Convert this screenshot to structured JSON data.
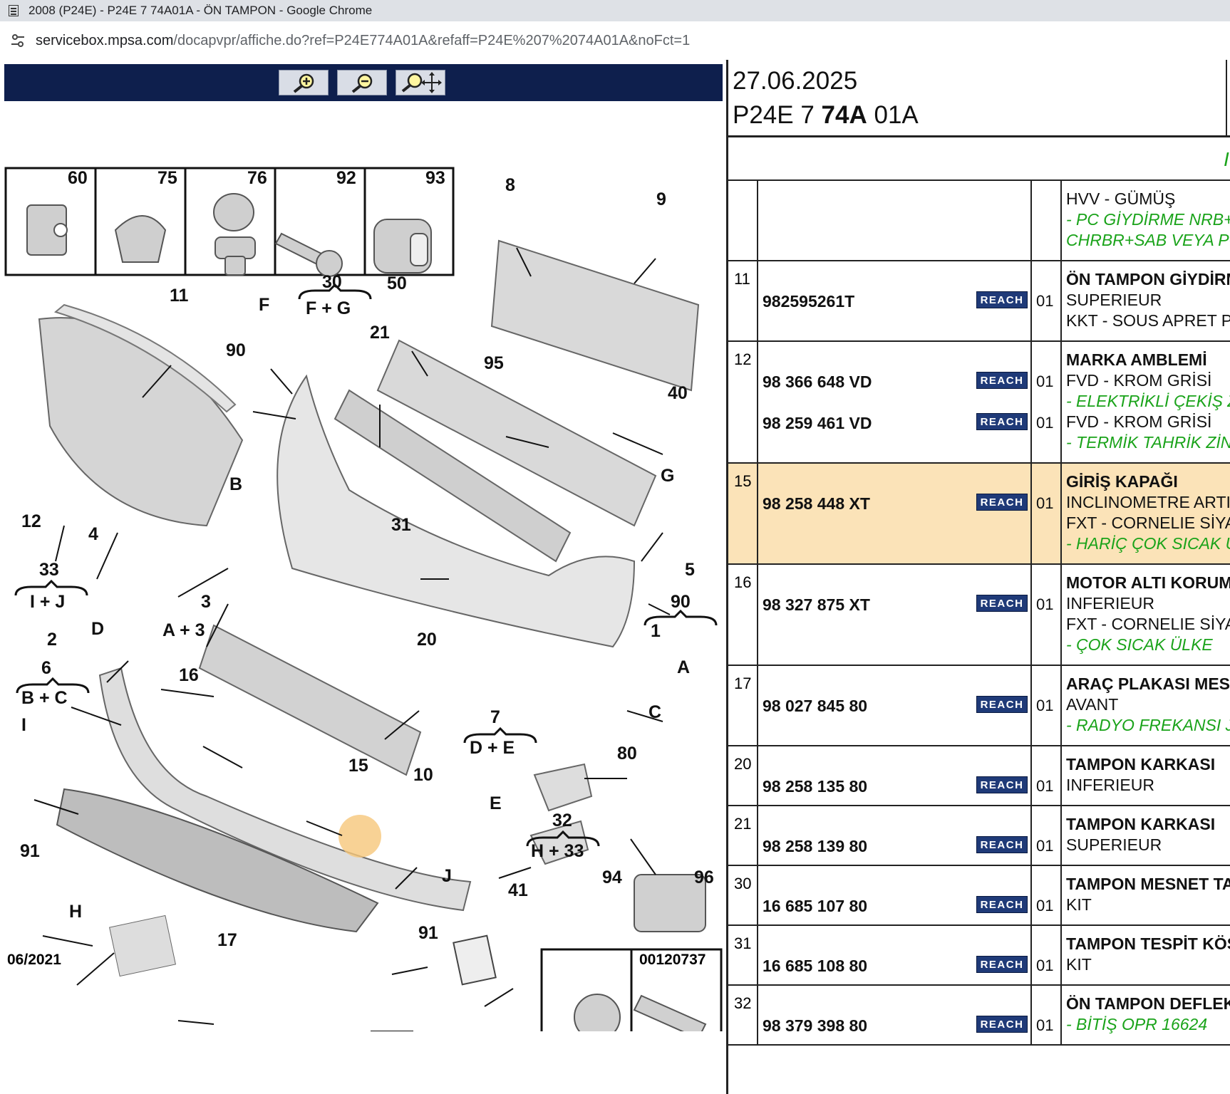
{
  "browser": {
    "title": "2008 (P24E) - P24E 7 74A01A - ÖN TAMPON - Google Chrome",
    "url_host": "servicebox.mpsa.com",
    "url_path": "/docapvpr/affiche.do?ref=P24E774A01A&refaff=P24E%207%2074A01A&noFct=1"
  },
  "toolbar": {
    "zoom_in": "zoom-in-icon",
    "zoom_out": "zoom-out-icon",
    "pan": "zoom-pan-icon"
  },
  "diagram": {
    "date": "06/2021",
    "code": "00120737",
    "highlight_color": "#f6c77a",
    "callouts": [
      "60",
      "75",
      "76",
      "92",
      "93",
      "8",
      "9",
      "11",
      "F",
      "30",
      "F + G",
      "50",
      "21",
      "90",
      "95",
      "40",
      "12",
      "4",
      "B",
      "31",
      "G",
      "33",
      "I + J",
      "3",
      "D",
      "5",
      "90",
      "1",
      "A + 3",
      "2",
      "20",
      "A",
      "6",
      "B + C",
      "16",
      "7",
      "D + E",
      "C",
      "I",
      "15",
      "80",
      "10",
      "E",
      "91",
      "32",
      "H + 33",
      "J",
      "41",
      "94",
      "96",
      "H",
      "17",
      "91"
    ]
  },
  "panel": {
    "date": "27.06.2025",
    "ref_prefix": "P24E 7 ",
    "ref_bold": "74A",
    "ref_suffix": " 01A",
    "band_mark": "I"
  },
  "rows": [
    {
      "no": "",
      "parts": [],
      "desc": [
        {
          "text": "HVV - GÜMÜŞ",
          "style": "n"
        },
        {
          "text": "- PC GİYDİRME NRB+IZ",
          "style": "g"
        },
        {
          "text": "CHRBR+SAB VEYA PC",
          "style": "g"
        }
      ]
    },
    {
      "no": "11",
      "parts": [
        {
          "pn": "982595261T",
          "qty": "01"
        }
      ],
      "desc": [
        {
          "text": "ÖN TAMPON GİYDİRME",
          "style": "t"
        },
        {
          "text": "SUPERIEUR",
          "style": "n"
        },
        {
          "text": "KKT - SOUS APRET PR",
          "style": "n"
        }
      ]
    },
    {
      "no": "12",
      "parts": [
        {
          "pn": "98 366 648 VD",
          "qty": "01"
        },
        {
          "pn": "98 259 461 VD",
          "qty": "01"
        }
      ],
      "desc": [
        {
          "text": "MARKA AMBLEMİ",
          "style": "t"
        },
        {
          "text": "FVD - KROM GRİSİ",
          "style": "n"
        },
        {
          "text": "- ELEKTRİKLİ ÇEKİŞ ZI",
          "style": "g"
        },
        {
          "text": "FVD - KROM GRİSİ",
          "style": "n"
        },
        {
          "text": "- TERMİK TAHRİK ZİNC",
          "style": "g"
        }
      ]
    },
    {
      "no": "15",
      "highlight": true,
      "parts": [
        {
          "pn": "98 258 448 XT",
          "qty": "01"
        }
      ],
      "desc": [
        {
          "text": "GİRİŞ KAPAĞI",
          "style": "t"
        },
        {
          "text": "INCLINOMETRE ARTIV",
          "style": "n"
        },
        {
          "text": "FXT - CORNELIE SİYAH",
          "style": "n"
        },
        {
          "text": "- HARİÇ ÇOK SICAK ÜL",
          "style": "g"
        }
      ]
    },
    {
      "no": "16",
      "parts": [
        {
          "pn": "98 327 875 XT",
          "qty": "01"
        }
      ],
      "desc": [
        {
          "text": "MOTOR ALTI KORUMA",
          "style": "t"
        },
        {
          "text": "INFERIEUR",
          "style": "n"
        },
        {
          "text": "FXT - CORNELIE SİYAH",
          "style": "n"
        },
        {
          "text": "- ÇOK SICAK ÜLKE",
          "style": "g"
        }
      ]
    },
    {
      "no": "17",
      "parts": [
        {
          "pn": "98 027 845 80",
          "qty": "01"
        }
      ],
      "desc": [
        {
          "text": "ARAÇ PLAKASI MESNE",
          "style": "t"
        },
        {
          "text": "AVANT",
          "style": "n"
        },
        {
          "text": "- RADYO FREKANSI JA",
          "style": "g"
        }
      ]
    },
    {
      "no": "20",
      "parts": [
        {
          "pn": "98 258 135 80",
          "qty": "01"
        }
      ],
      "desc": [
        {
          "text": "TAMPON KARKASI",
          "style": "t"
        },
        {
          "text": "INFERIEUR",
          "style": "n"
        }
      ]
    },
    {
      "no": "21",
      "parts": [
        {
          "pn": "98 258 139 80",
          "qty": "01"
        }
      ],
      "desc": [
        {
          "text": "TAMPON KARKASI",
          "style": "t"
        },
        {
          "text": "SUPERIEUR",
          "style": "n"
        }
      ]
    },
    {
      "no": "30",
      "parts": [
        {
          "pn": "16 685 107 80",
          "qty": "01"
        }
      ],
      "desc": [
        {
          "text": "TAMPON MESNET TAK",
          "style": "t"
        },
        {
          "text": "KIT",
          "style": "n"
        }
      ]
    },
    {
      "no": "31",
      "parts": [
        {
          "pn": "16 685 108 80",
          "qty": "01"
        }
      ],
      "desc": [
        {
          "text": "TAMPON TESPİT KÖŞE",
          "style": "t"
        },
        {
          "text": "KIT",
          "style": "n"
        }
      ]
    },
    {
      "no": "32",
      "parts": [
        {
          "pn": "98 379 398 80",
          "qty": "01"
        }
      ],
      "desc": [
        {
          "text": "ÖN TAMPON DEFLEKT",
          "style": "t"
        },
        {
          "text": "- BİTİŞ OPR 16624",
          "style": "g"
        }
      ]
    }
  ],
  "reach_label": "REACH"
}
